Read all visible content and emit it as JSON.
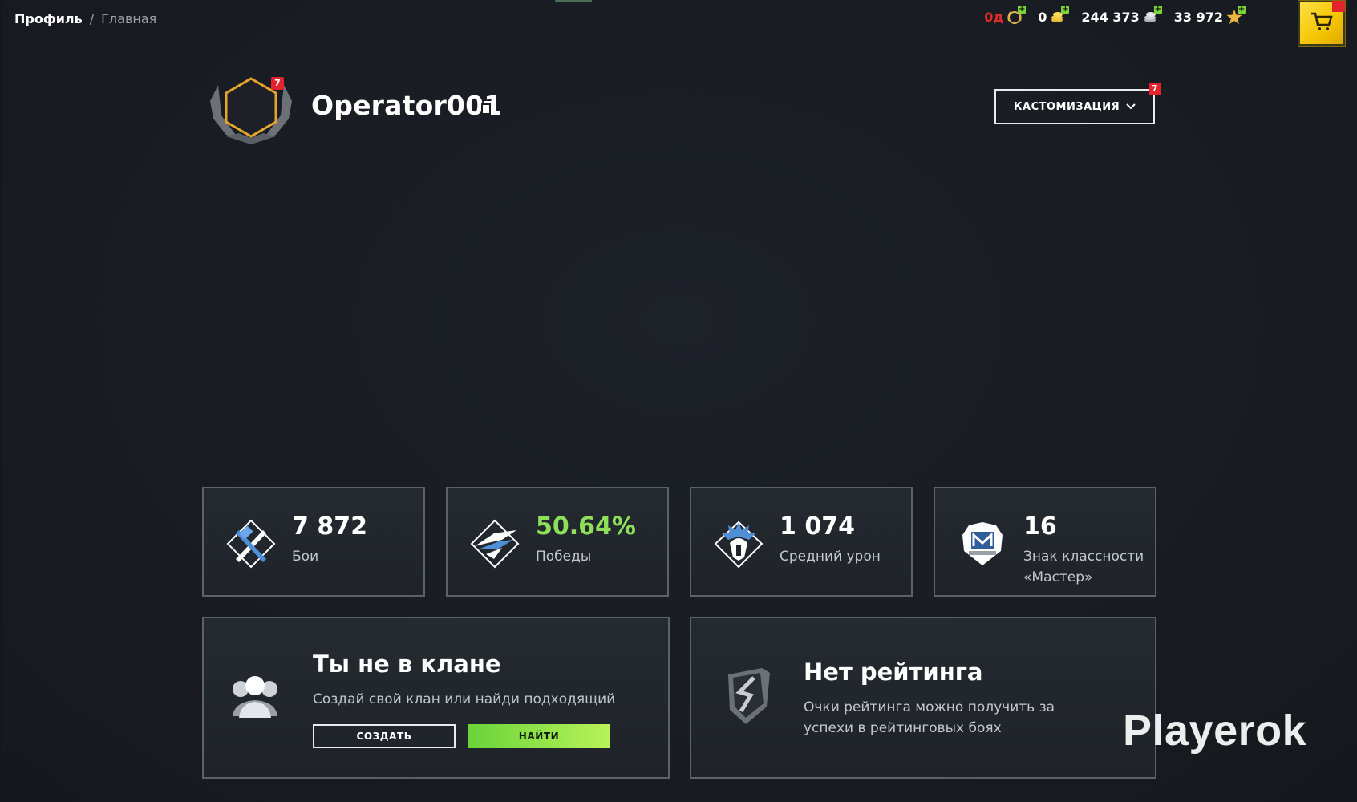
{
  "breadcrumb": {
    "current": "Профиль",
    "separator": "/",
    "link": "Главная"
  },
  "currencies": [
    {
      "value": "0д",
      "icon": "premium-laurel-icon",
      "red": true
    },
    {
      "value": "0",
      "icon": "gold-coins-icon",
      "red": false
    },
    {
      "value": "244 373",
      "icon": "silver-credits-icon",
      "red": false
    },
    {
      "value": "33 972",
      "icon": "free-xp-star-icon",
      "red": false
    }
  ],
  "shop": {
    "icon": "shop-cart-icon"
  },
  "profile": {
    "username": "Operator001",
    "avatar_badge": "7"
  },
  "customize": {
    "label": "КАСТОМИЗАЦИЯ",
    "badge": "7"
  },
  "stats": [
    {
      "value": "7 872",
      "label": "Бои",
      "icon": "crossed-swords-icon"
    },
    {
      "value": "50.64%",
      "label": "Победы",
      "icon": "victory-wings-icon",
      "green": true
    },
    {
      "value": "1 074",
      "label": "Средний урон",
      "icon": "damage-burst-icon"
    },
    {
      "value": "16",
      "label": "Знак классности «Мастер»",
      "icon": "mastery-badge-icon"
    }
  ],
  "clan": {
    "title": "Ты не в клане",
    "text": "Создай свой клан или найди подходящий",
    "create_label": "СОЗДАТЬ",
    "find_label": "НАЙТИ"
  },
  "rating": {
    "title": "Нет рейтинга",
    "text": "Очки рейтинга можно получить за успехи в рейтинговых боях"
  },
  "watermark": "Playerok",
  "colors": {
    "accent_green": "#8ee05a",
    "badge_red": "#e3222c",
    "shop_yellow": "#f4c400"
  }
}
